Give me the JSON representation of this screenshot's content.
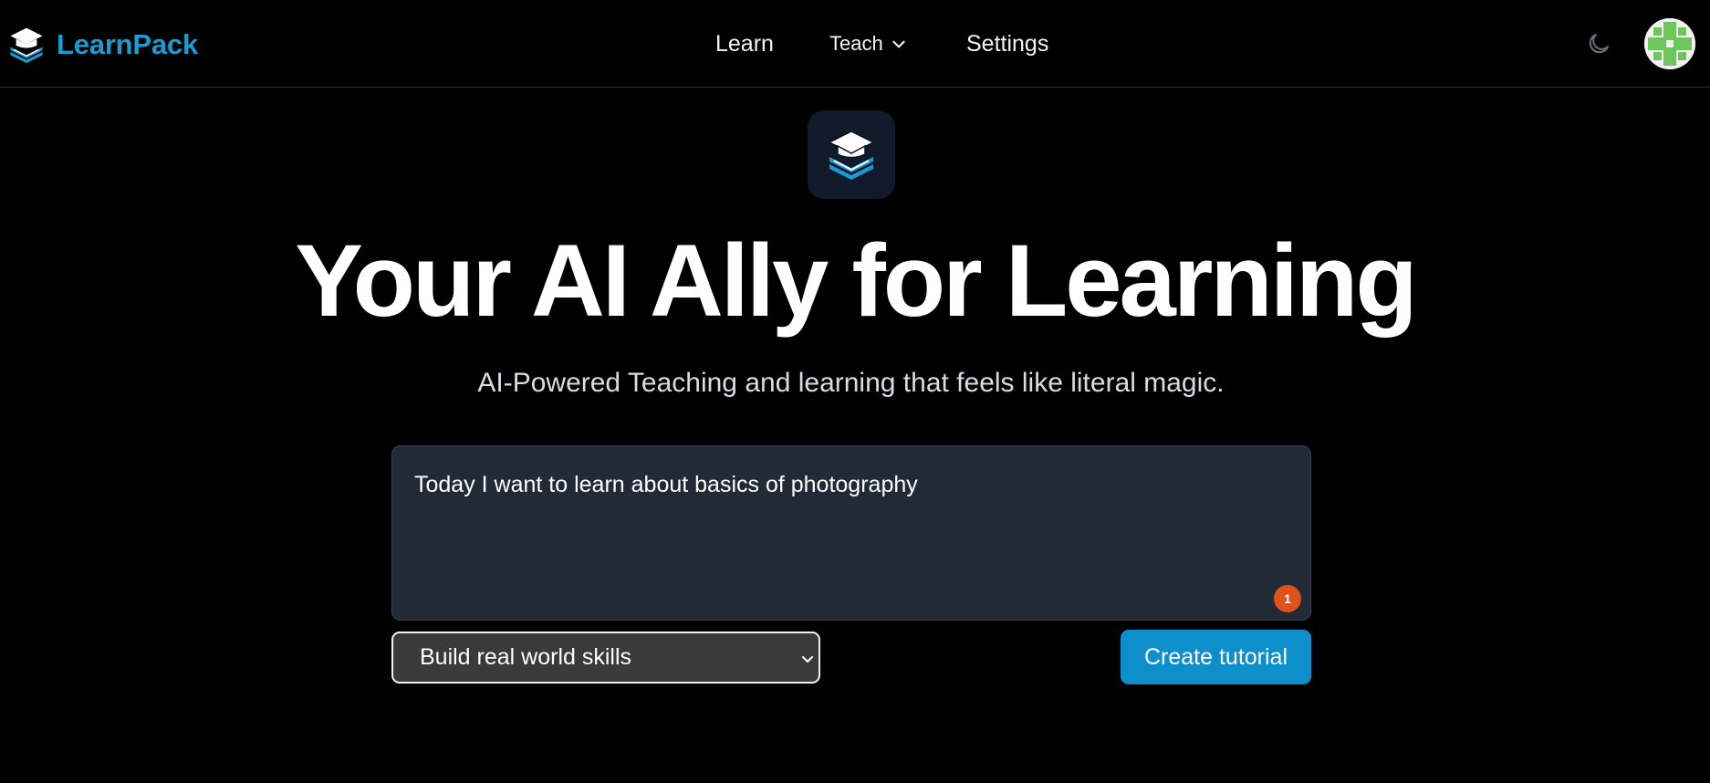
{
  "brand": {
    "name": "LearnPack",
    "logo_icon": "graduation-cap-books-icon",
    "color": "#1a9bd1"
  },
  "nav": {
    "learn": "Learn",
    "teach": "Teach",
    "settings": "Settings"
  },
  "header_icons": {
    "theme_toggle": "moon-icon",
    "avatar": "user-avatar"
  },
  "hero": {
    "title": "Your AI Ally for Learning",
    "subtitle": "AI-Powered Teaching and learning that feels like literal magic."
  },
  "prompt": {
    "value": "Today I want to learn about basics of photography",
    "badge_count": "1"
  },
  "goal_select": {
    "selected": "Build real world skills"
  },
  "create_button": {
    "label": "Create tutorial",
    "color": "#0d8fcb"
  }
}
